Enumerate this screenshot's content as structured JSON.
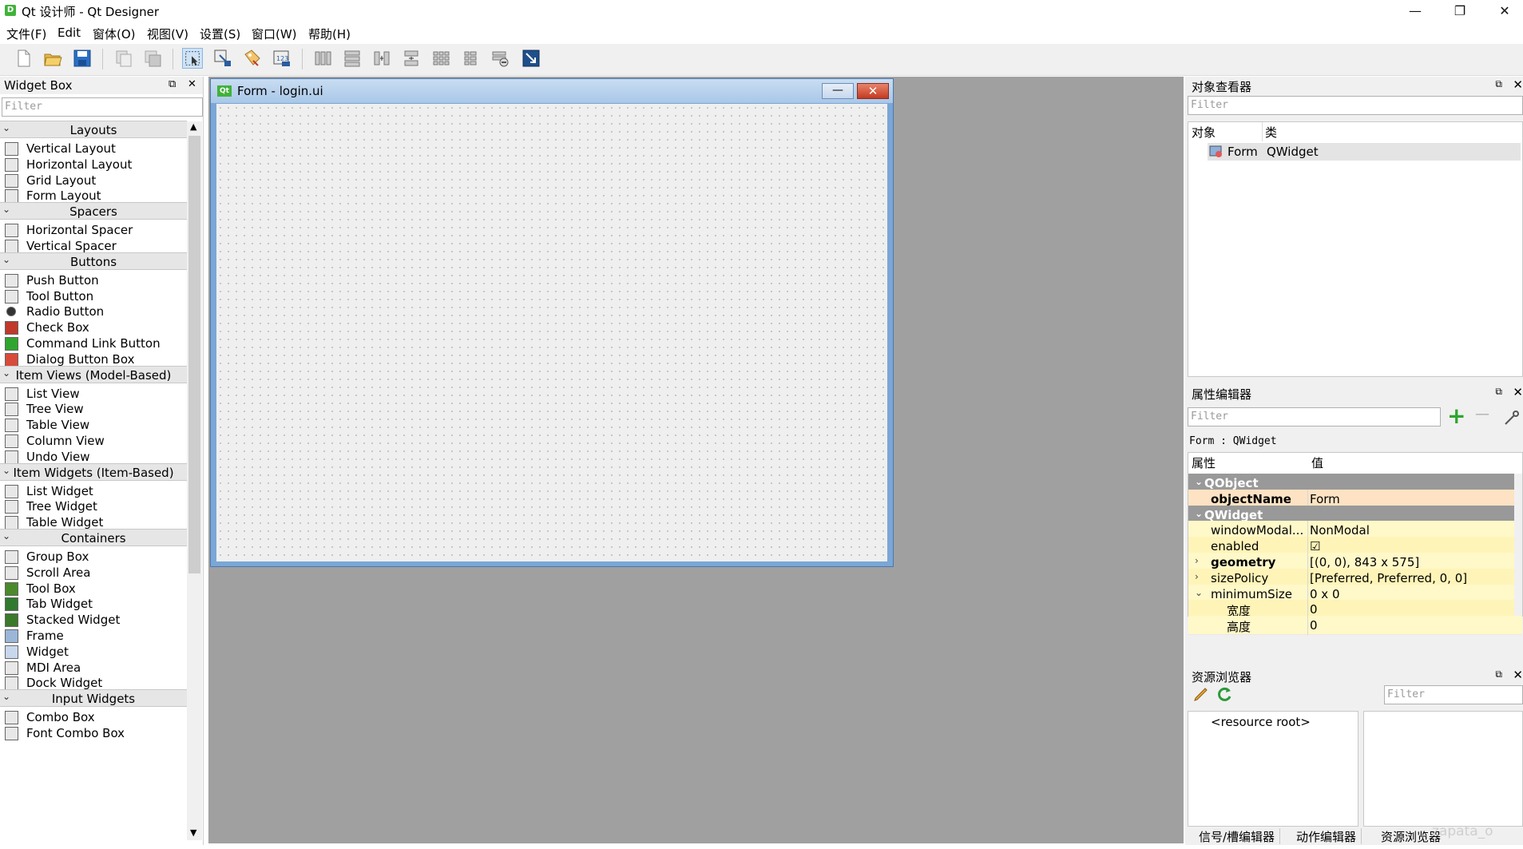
{
  "window": {
    "title": "Qt 设计师 - Qt Designer",
    "app_icon_letter": "D",
    "minimize": "—",
    "maximize": "❐",
    "close": "✕"
  },
  "menu": [
    "文件(F)",
    "Edit",
    "窗体(O)",
    "视图(V)",
    "设置(S)",
    "窗口(W)",
    "帮助(H)"
  ],
  "widget_box": {
    "title": "Widget Box",
    "float_btn": "⧉",
    "close_btn": "✕",
    "filter_placeholder": "Filter",
    "categories": [
      {
        "name": "Layouts",
        "items": [
          "Vertical Layout",
          "Horizontal Layout",
          "Grid Layout",
          "Form Layout"
        ]
      },
      {
        "name": "Spacers",
        "items": [
          "Horizontal Spacer",
          "Vertical Spacer"
        ]
      },
      {
        "name": "Buttons",
        "items": [
          "Push Button",
          "Tool Button",
          "Radio Button",
          "Check Box",
          "Command Link Button",
          "Dialog Button Box"
        ]
      },
      {
        "name": "Item Views (Model-Based)",
        "items": [
          "List View",
          "Tree View",
          "Table View",
          "Column View",
          "Undo View"
        ]
      },
      {
        "name": "Item Widgets (Item-Based)",
        "items": [
          "List Widget",
          "Tree Widget",
          "Table Widget"
        ]
      },
      {
        "name": "Containers",
        "items": [
          "Group Box",
          "Scroll Area",
          "Tool Box",
          "Tab Widget",
          "Stacked Widget",
          "Frame",
          "Widget",
          "MDI Area",
          "Dock Widget"
        ]
      },
      {
        "name": "Input Widgets",
        "items": [
          "Combo Box",
          "Font Combo Box"
        ]
      }
    ]
  },
  "form": {
    "title": "Form - login.ui",
    "icon_text": "Qt",
    "min_label": "—",
    "close_label": "✕"
  },
  "object_inspector": {
    "title": "对象查看器",
    "filter_placeholder": "Filter",
    "col_object": "对象",
    "col_class": "类",
    "row_object": "Form",
    "row_class": "QWidget"
  },
  "property_editor": {
    "title": "属性编辑器",
    "filter_placeholder": "Filter",
    "add_btn": "+",
    "remove_btn": "—",
    "context": "Form : QWidget",
    "col_property": "属性",
    "col_value": "值",
    "rows": [
      {
        "name": "QObject",
        "value": "",
        "kind": "group"
      },
      {
        "name": "objectName",
        "value": "Form",
        "kind": "bold"
      },
      {
        "name": "QWidget",
        "value": "",
        "kind": "group"
      },
      {
        "name": "windowModal...",
        "value": "NonModal",
        "kind": "plain"
      },
      {
        "name": "enabled",
        "value": "☑",
        "kind": "plain"
      },
      {
        "name": "geometry",
        "value": "[(0, 0), 843 x 575]",
        "kind": "bold",
        "expand": "›"
      },
      {
        "name": "sizePolicy",
        "value": "[Preferred, Preferred, 0, 0]",
        "kind": "plain",
        "expand": "›"
      },
      {
        "name": "minimumSize",
        "value": "0 x 0",
        "kind": "plain",
        "expand": "⌄"
      },
      {
        "name": "宽度",
        "value": "0",
        "kind": "child"
      },
      {
        "name": "高度",
        "value": "0",
        "kind": "child"
      }
    ]
  },
  "resource_browser": {
    "title": "资源浏览器",
    "filter_placeholder": "Filter",
    "root": "<resource root>"
  },
  "bottom_tabs": [
    "信号/槽编辑器",
    "动作编辑器",
    "资源浏览器"
  ],
  "watermark": "zapata_o"
}
